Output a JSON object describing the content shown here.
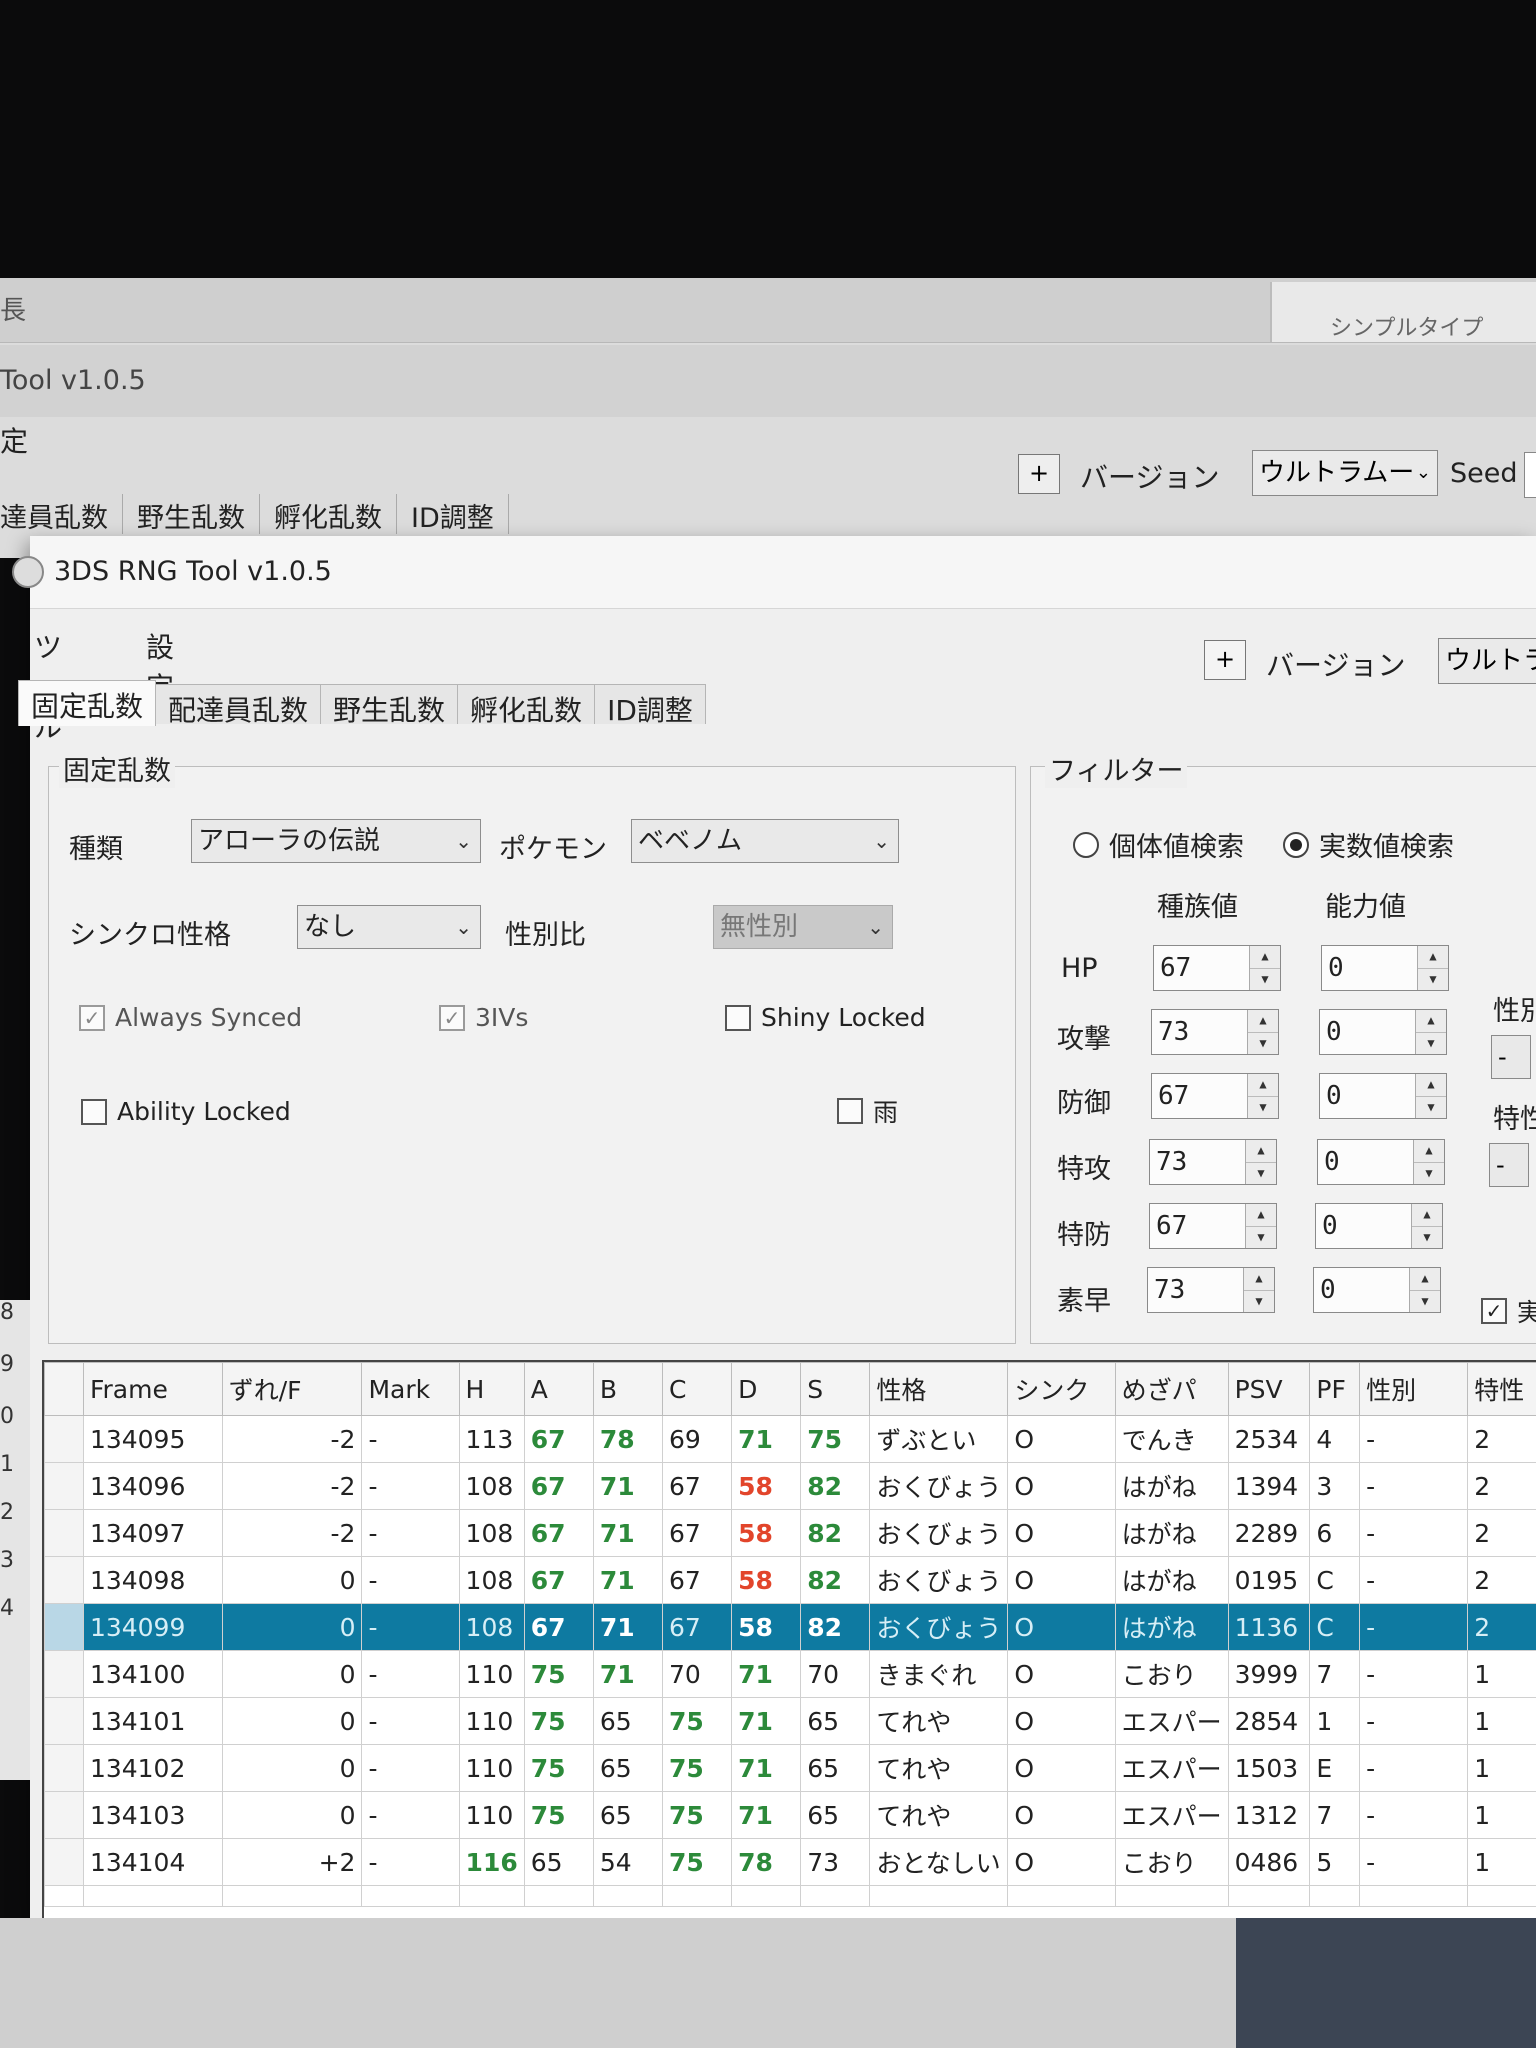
{
  "background_window": {
    "top_char": "長",
    "right_tab_label": "シンプルタイプ",
    "title": "Tool v1.0.5",
    "menu_char": "定",
    "tabs": [
      "達員乱数",
      "野生乱数",
      "孵化乱数",
      "ID調整"
    ],
    "plus": "+",
    "version_label": "バージョン",
    "version_value": "ウルトラムー",
    "seed_label": "Seed"
  },
  "window": {
    "title": "3DS RNG Tool v1.0.5",
    "menu": [
      "ツール",
      "設定"
    ],
    "plus": "+",
    "version_label": "バージョン",
    "version_value": "ウルトラ"
  },
  "tabs": [
    "固定乱数",
    "配達員乱数",
    "野生乱数",
    "孵化乱数",
    "ID調整"
  ],
  "fixed_panel": {
    "legend": "固定乱数",
    "type_label": "種類",
    "type_value": "アローラの伝説",
    "pokemon_label": "ポケモン",
    "pokemon_value": "ベベノム",
    "sync_label": "シンクロ性格",
    "sync_value": "なし",
    "gender_ratio_label": "性別比",
    "gender_ratio_value": "無性別",
    "always_synced": "Always Synced",
    "three_ivs": "3IVs",
    "shiny_locked": "Shiny Locked",
    "ability_locked": "Ability Locked",
    "rain": "雨"
  },
  "filter_panel": {
    "legend": "フィルター",
    "radio_iv": "個体値検索",
    "radio_stat": "実数値検索",
    "col_base": "種族値",
    "col_stat": "能力値",
    "stats": [
      {
        "label": "HP",
        "base": "67",
        "stat": "0"
      },
      {
        "label": "攻撃",
        "base": "73",
        "stat": "0"
      },
      {
        "label": "防御",
        "base": "67",
        "stat": "0"
      },
      {
        "label": "特攻",
        "base": "73",
        "stat": "0"
      },
      {
        "label": "特防",
        "base": "67",
        "stat": "0"
      },
      {
        "label": "素早",
        "base": "73",
        "stat": "0"
      }
    ],
    "side_gender_label": "性別",
    "side_gender_value": "-",
    "side_ability_label": "特性",
    "side_ability_value": "-",
    "side_check_label": "実"
  },
  "table": {
    "headers": [
      "Frame",
      "ずれ/F",
      "Mark",
      "H",
      "A",
      "B",
      "C",
      "D",
      "S",
      "性格",
      "シンク",
      "めざパ",
      "PSV",
      "PF",
      "性別",
      "特性"
    ],
    "rows": [
      {
        "frame": "134095",
        "shift": "-2",
        "mark": "-",
        "h": "113",
        "a": "67",
        "b": "78",
        "c": "69",
        "d": "71",
        "s": "75",
        "nature": "ずぶとい",
        "sync": "O",
        "hp": "でんき",
        "psv": "2534",
        "pf": "4",
        "gender": "-",
        "ability": "2"
      },
      {
        "frame": "134096",
        "shift": "-2",
        "mark": "-",
        "h": "108",
        "a": "67",
        "b": "71",
        "c": "67",
        "d": "58",
        "s": "82",
        "nature": "おくびょう",
        "sync": "O",
        "hp": "はがね",
        "psv": "1394",
        "pf": "3",
        "gender": "-",
        "ability": "2"
      },
      {
        "frame": "134097",
        "shift": "-2",
        "mark": "-",
        "h": "108",
        "a": "67",
        "b": "71",
        "c": "67",
        "d": "58",
        "s": "82",
        "nature": "おくびょう",
        "sync": "O",
        "hp": "はがね",
        "psv": "2289",
        "pf": "6",
        "gender": "-",
        "ability": "2"
      },
      {
        "frame": "134098",
        "shift": "0",
        "mark": "-",
        "h": "108",
        "a": "67",
        "b": "71",
        "c": "67",
        "d": "58",
        "s": "82",
        "nature": "おくびょう",
        "sync": "O",
        "hp": "はがね",
        "psv": "0195",
        "pf": "C",
        "gender": "-",
        "ability": "2"
      },
      {
        "frame": "134099",
        "shift": "0",
        "mark": "-",
        "h": "108",
        "a": "67",
        "b": "71",
        "c": "67",
        "d": "58",
        "s": "82",
        "nature": "おくびょう",
        "sync": "O",
        "hp": "はがね",
        "psv": "1136",
        "pf": "C",
        "gender": "-",
        "ability": "2"
      },
      {
        "frame": "134100",
        "shift": "0",
        "mark": "-",
        "h": "110",
        "a": "75",
        "b": "71",
        "c": "70",
        "d": "71",
        "s": "70",
        "nature": "きまぐれ",
        "sync": "O",
        "hp": "こおり",
        "psv": "3999",
        "pf": "7",
        "gender": "-",
        "ability": "1"
      },
      {
        "frame": "134101",
        "shift": "0",
        "mark": "-",
        "h": "110",
        "a": "75",
        "b": "65",
        "c": "75",
        "d": "71",
        "s": "65",
        "nature": "てれや",
        "sync": "O",
        "hp": "エスパー",
        "psv": "2854",
        "pf": "1",
        "gender": "-",
        "ability": "1"
      },
      {
        "frame": "134102",
        "shift": "0",
        "mark": "-",
        "h": "110",
        "a": "75",
        "b": "65",
        "c": "75",
        "d": "71",
        "s": "65",
        "nature": "てれや",
        "sync": "O",
        "hp": "エスパー",
        "psv": "1503",
        "pf": "E",
        "gender": "-",
        "ability": "1"
      },
      {
        "frame": "134103",
        "shift": "0",
        "mark": "-",
        "h": "110",
        "a": "75",
        "b": "65",
        "c": "75",
        "d": "71",
        "s": "65",
        "nature": "てれや",
        "sync": "O",
        "hp": "エスパー",
        "psv": "1312",
        "pf": "7",
        "gender": "-",
        "ability": "1"
      },
      {
        "frame": "134104",
        "shift": "+2",
        "mark": "-",
        "h": "116",
        "a": "65",
        "b": "54",
        "c": "75",
        "d": "78",
        "s": "73",
        "nature": "おとなしい",
        "sync": "O",
        "hp": "こおり",
        "psv": "0486",
        "pf": "5",
        "gender": "-",
        "ability": "1"
      }
    ],
    "selected_index": 4
  },
  "left_edge_digits": [
    "8",
    "9",
    "0",
    "1",
    "2",
    "3",
    "4"
  ],
  "colors": {
    "green": "#2c8a3a",
    "red": "#e2452b",
    "selection": "#0e7aa1"
  }
}
